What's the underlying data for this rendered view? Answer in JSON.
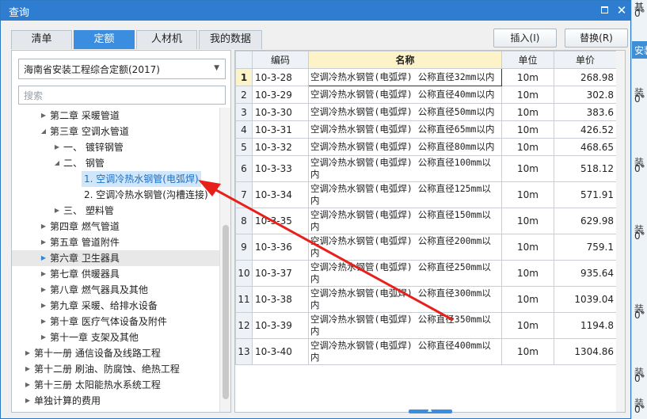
{
  "window": {
    "title": "查询"
  },
  "tabs": [
    {
      "label": "清单",
      "active": false
    },
    {
      "label": "定额",
      "active": true
    },
    {
      "label": "人材机",
      "active": false
    },
    {
      "label": "我的数据",
      "active": false
    }
  ],
  "buttons": {
    "insert": "插入(I)",
    "replace": "替换(R)"
  },
  "quota_library": {
    "selected": "海南省安装工程综合定额(2017)"
  },
  "search": {
    "placeholder": "搜索"
  },
  "tree": [
    {
      "label": "第二章 采暖管道",
      "expanded": false
    },
    {
      "label": "第三章 空调水管道",
      "expanded": true
    },
    {
      "label": "一、 镀锌钢管",
      "expanded": false
    },
    {
      "label": "二、 钢管",
      "expanded": true
    },
    {
      "label": "1. 空调冷热水钢管(电弧焊)",
      "selected": true
    },
    {
      "label": "2. 空调冷热水钢管(沟槽连接)"
    },
    {
      "label": "三、 塑料管",
      "expanded": false
    },
    {
      "label": "第四章 燃气管道",
      "expanded": false
    },
    {
      "label": "第五章 管道附件",
      "expanded": false
    },
    {
      "label": "第六章 卫生器具",
      "expanded": false,
      "hover": true
    },
    {
      "label": "第七章 供暖器具",
      "expanded": false
    },
    {
      "label": "第八章 燃气器具及其他",
      "expanded": false
    },
    {
      "label": "第九章 采暖、给排水设备",
      "expanded": false
    },
    {
      "label": "第十章 医疗气体设备及附件",
      "expanded": false
    },
    {
      "label": "第十一章 支架及其他",
      "expanded": false
    },
    {
      "label": "第十一册 通信设备及线路工程",
      "expanded": false
    },
    {
      "label": "第十二册 刷油、防腐蚀、绝热工程",
      "expanded": false
    },
    {
      "label": "第十三册 太阳能热水系统工程",
      "expanded": false
    },
    {
      "label": "单独计算的费用",
      "expanded": false
    }
  ],
  "grid": {
    "headers": {
      "code": "编码",
      "name": "名称",
      "unit": "单位",
      "price": "单价"
    },
    "rows": [
      {
        "n": "1",
        "code": "10-3-28",
        "name": "空调冷热水钢管(电弧焊) 公称直径32mm以内",
        "unit": "10m",
        "price": "268.98"
      },
      {
        "n": "2",
        "code": "10-3-29",
        "name": "空调冷热水钢管(电弧焊) 公称直径40mm以内",
        "unit": "10m",
        "price": "302.8"
      },
      {
        "n": "3",
        "code": "10-3-30",
        "name": "空调冷热水钢管(电弧焊) 公称直径50mm以内",
        "unit": "10m",
        "price": "383.6"
      },
      {
        "n": "4",
        "code": "10-3-31",
        "name": "空调冷热水钢管(电弧焊) 公称直径65mm以内",
        "unit": "10m",
        "price": "426.52"
      },
      {
        "n": "5",
        "code": "10-3-32",
        "name": "空调冷热水钢管(电弧焊) 公称直径80mm以内",
        "unit": "10m",
        "price": "468.65"
      },
      {
        "n": "6",
        "code": "10-3-33",
        "name": "空调冷热水钢管(电弧焊) 公称直径100mm以内",
        "unit": "10m",
        "price": "518.12"
      },
      {
        "n": "7",
        "code": "10-3-34",
        "name": "空调冷热水钢管(电弧焊) 公称直径125mm以内",
        "unit": "10m",
        "price": "571.91"
      },
      {
        "n": "8",
        "code": "10-3-35",
        "name": "空调冷热水钢管(电弧焊) 公称直径150mm以内",
        "unit": "10m",
        "price": "629.98"
      },
      {
        "n": "9",
        "code": "10-3-36",
        "name": "空调冷热水钢管(电弧焊) 公称直径200mm以内",
        "unit": "10m",
        "price": "759.1"
      },
      {
        "n": "10",
        "code": "10-3-37",
        "name": "空调冷热水钢管(电弧焊) 公称直径250mm以内",
        "unit": "10m",
        "price": "935.64"
      },
      {
        "n": "11",
        "code": "10-3-38",
        "name": "空调冷热水钢管(电弧焊) 公称直径300mm以内",
        "unit": "10m",
        "price": "1039.04"
      },
      {
        "n": "12",
        "code": "10-3-39",
        "name": "空调冷热水钢管(电弧焊) 公称直径350mm以内",
        "unit": "10m",
        "price": "1194.8"
      },
      {
        "n": "13",
        "code": "10-3-40",
        "name": "空调冷热水钢管(电弧焊) 公称直径400mm以内",
        "unit": "10m",
        "price": "1304.86"
      }
    ]
  },
  "background_app": {
    "fragments": [
      "基",
      "0°",
      "安装",
      "装",
      "0°",
      "装",
      "0°",
      "装",
      "0°",
      "装",
      "0°",
      "装",
      "0°",
      "装",
      "0°"
    ]
  },
  "colors": {
    "titlebar": "#2e7dd1",
    "tab_active": "#3b8de0",
    "selection": "#cfe6fb",
    "header_highlight": "#fdf3c8",
    "annotation_arrow": "#e8201c"
  }
}
